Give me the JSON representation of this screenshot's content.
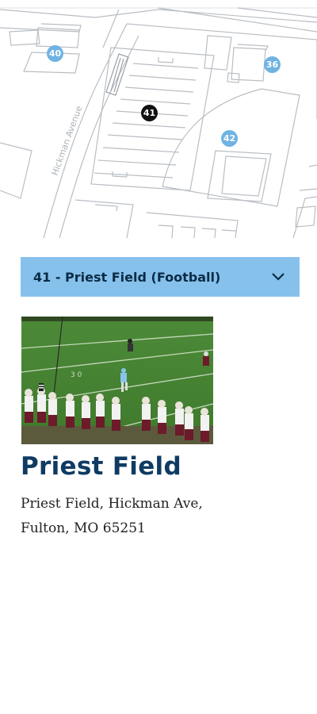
{
  "map": {
    "street_label": "Hickman Avenue",
    "markers": [
      {
        "id": "40",
        "color": "#6fb3e2"
      },
      {
        "id": "36",
        "color": "#6fb3e2"
      },
      {
        "id": "41",
        "color": "#111111"
      },
      {
        "id": "42",
        "color": "#6fb3e2"
      }
    ]
  },
  "selector": {
    "label": "41 - Priest Field (Football)",
    "icon": "chevron-down-icon",
    "background": "#86c1ec"
  },
  "location": {
    "photo_alt": "Football game on Priest Field",
    "title": "Priest Field",
    "address_line1": "Priest Field, Hickman Ave,",
    "address_line2": "Fulton, MO 65251",
    "title_color": "#0f3b63"
  }
}
